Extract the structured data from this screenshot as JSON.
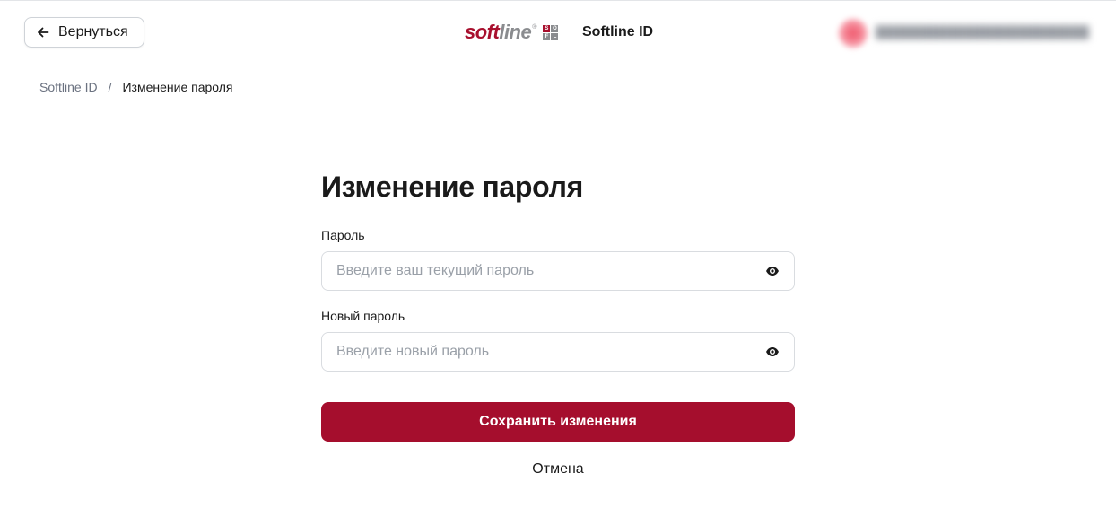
{
  "header": {
    "back_label": "Вернуться",
    "brand": {
      "logo_soft": "soft",
      "logo_line": "line",
      "logo_reg": "®",
      "sofl_letters": [
        "S",
        "O",
        "F",
        "L"
      ],
      "app_name": "Softline ID"
    }
  },
  "breadcrumb": {
    "root": "Softline ID",
    "separator": "/",
    "current": "Изменение пароля"
  },
  "form": {
    "title": "Изменение пароля",
    "password": {
      "label": "Пароль",
      "placeholder": "Введите ваш текущий пароль",
      "value": ""
    },
    "new_password": {
      "label": "Новый пароль",
      "placeholder": "Введите новый пароль",
      "value": ""
    },
    "save_label": "Сохранить изменения",
    "cancel_label": "Отмена"
  },
  "icons": {
    "back": "arrow-left-icon",
    "toggle_visibility": "eye-icon"
  },
  "colors": {
    "brand_red": "#a50e2d",
    "logo_gray": "#8a8c8f",
    "text": "#1a1a1a",
    "muted": "#6b7280",
    "border": "#d9dce0"
  }
}
